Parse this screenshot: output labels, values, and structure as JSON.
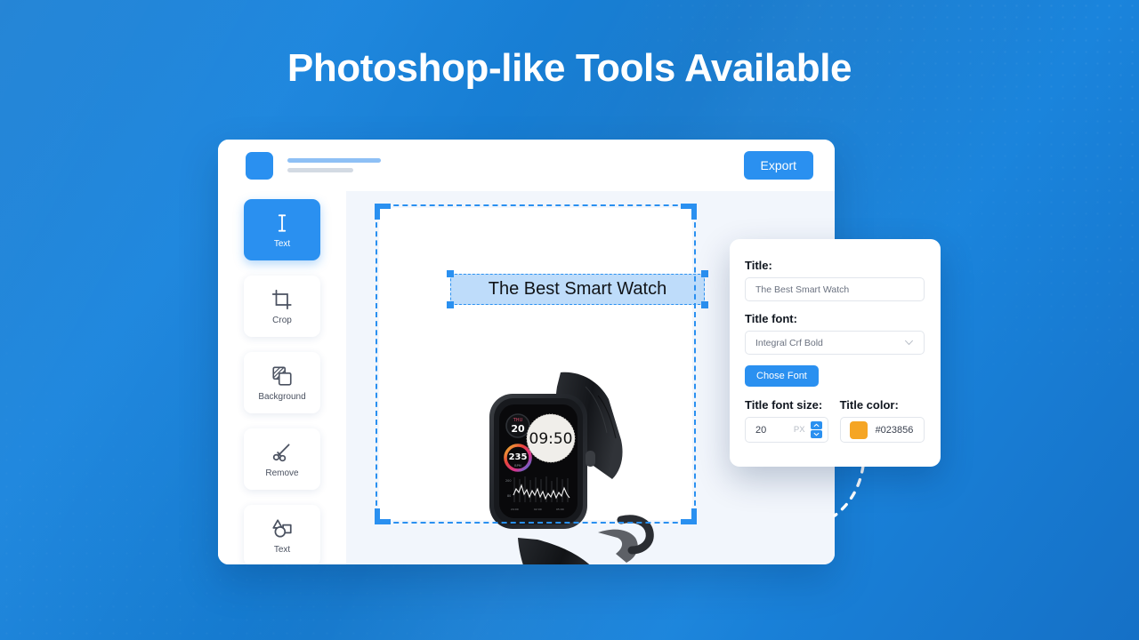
{
  "headline": {
    "highlighted": "Photoshop-like",
    "rest": " Tools Available"
  },
  "colors": {
    "brand_blue": "#2a90f0",
    "background_blue": "#1478cc",
    "swatch": "#f5a524",
    "selection": "#2a90f0",
    "text_highlight": "#bedcfa"
  },
  "topbar": {
    "logo_name": "app-logo",
    "export_label": "Export"
  },
  "sidebar": {
    "tools": [
      {
        "label": "Text",
        "icon": "text-cursor-icon",
        "active": true
      },
      {
        "label": "Crop",
        "icon": "crop-icon",
        "active": false
      },
      {
        "label": "Background",
        "icon": "background-icon",
        "active": false
      },
      {
        "label": "Remove",
        "icon": "scissors-icon",
        "active": false
      },
      {
        "label": "Text",
        "icon": "shapes-icon",
        "active": false
      }
    ]
  },
  "canvas": {
    "text_layer": "The Best Smart Watch",
    "watch": {
      "time": "09:50",
      "day": "THU",
      "date": "20",
      "bpm_value": "235",
      "bpm_unit": "BPM",
      "chart_high": "200",
      "chart_low": "80",
      "chart_ticks": [
        "24:00",
        "02:00",
        "05:00"
      ]
    }
  },
  "properties": {
    "title_label": "Title:",
    "title_value": "The Best Smart Watch",
    "title_font_label": "Title font:",
    "title_font_value": "Integral Crf Bold",
    "chose_font_label": "Chose Font",
    "font_size_label": "Title font size:",
    "font_size_value": "20",
    "font_size_unit": "PX",
    "color_label": "Title color:",
    "color_value": "#023856"
  }
}
